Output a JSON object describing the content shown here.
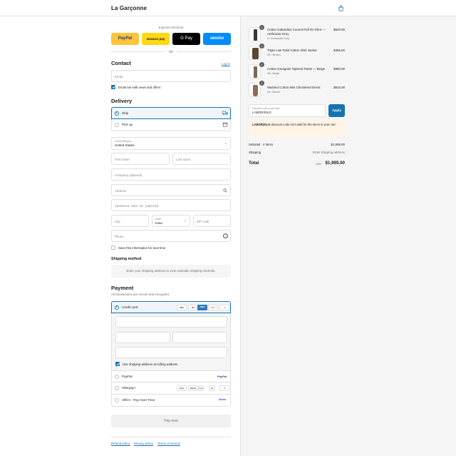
{
  "header": {
    "brand": "La Garçonne",
    "cart_icon": "shopping-bag-icon"
  },
  "express": {
    "label": "Express checkout",
    "or": "OR",
    "buttons": [
      {
        "label": "PayPal",
        "bg": "#ffc439",
        "color": "#253b80"
      },
      {
        "label": "amazon pay",
        "bg": "#ffd814",
        "color": "#0f1111"
      },
      {
        "label": "G Pay",
        "bg": "#000000",
        "color": "#ffffff"
      },
      {
        "label": "venmo",
        "bg": "#008cff",
        "color": "#ffffff"
      }
    ]
  },
  "contact": {
    "title": "Contact",
    "login": "Log in",
    "email_placeholder": "Email",
    "newsletter": "Email me with news and offers",
    "newsletter_checked": true
  },
  "delivery": {
    "title": "Delivery",
    "options": [
      {
        "label": "Ship",
        "selected": true,
        "icon": "truck-icon"
      },
      {
        "label": "Pick up",
        "selected": false,
        "icon": "store-icon"
      }
    ],
    "country_label": "Country/Region",
    "country_value": "United States",
    "first_name": "First name",
    "last_name": "Last name",
    "company": "Company (optional)",
    "address": "Address",
    "apartment": "Apartment, suite, etc. (optional)",
    "city": "City",
    "state_label": "State",
    "state_value": "Iowa",
    "zip": "ZIP code",
    "phone": "Phone",
    "save_info": "Save this information for next time"
  },
  "shipping_method": {
    "title": "Shipping method",
    "message": "Enter your shipping address to view available shipping methods."
  },
  "payment": {
    "title": "Payment",
    "subtitle": "All transactions are secure and encrypted.",
    "credit_card": "Credit card",
    "card_brands": [
      {
        "label": "VISA",
        "bg": "#ffffff",
        "color": "#1a1f71"
      },
      {
        "label": "MC",
        "bg": "#ffffff",
        "color": "#eb001b"
      },
      {
        "label": "AMEX",
        "bg": "#2e77bc",
        "color": "#ffffff"
      },
      {
        "label": "DISC",
        "bg": "#ffffff",
        "color": "#f48120"
      }
    ],
    "more_cards": "+4",
    "billing_same": "Use shipping address as billing address",
    "paypal": "PayPal",
    "paypal_logo": "PayPal",
    "afterpay": "Afterpay+",
    "afterpay_logos": [
      "Bank",
      "Klarna",
      "GPay",
      "AP"
    ],
    "afterpay_more": "+5",
    "affirm": "Affirm - Pay Over Time",
    "affirm_logo": "affirm",
    "pay_now": "Pay now"
  },
  "footer": {
    "links": [
      "Refund policy",
      "Privacy policy",
      "Terms of service"
    ]
  },
  "cart": {
    "items": [
      {
        "qty": "1",
        "name": "Cotton Gabardine Curved Pull On Pant — Anthracite Grey",
        "variant": "0 / Anthracite Grey",
        "price": "$520.00",
        "thumb_color": "#3a3a3a"
      },
      {
        "qty": "1",
        "name": "Triple Low Twist Cotton Shirt Jacket",
        "variant": "3S / Brown",
        "price": "$485.00",
        "thumb_color": "#5a4632"
      },
      {
        "qty": "1",
        "name": "Cotton Grosgrain Tapered Pants — Beige",
        "variant": "34 / Beige",
        "price": "$360.00",
        "thumb_color": "#7a6a55"
      },
      {
        "qty": "1",
        "name": "Washed Cotton Mini Checkered Dress",
        "variant": "34 / Brown",
        "price": "$615.00",
        "thumb_color": "#8a6e55"
      }
    ],
    "discount_label": "Discount code or gift card",
    "discount_value": "LABOR20LG",
    "apply": "Apply",
    "warning_code": "LABOR20LG",
    "warning_text": " discount code isn't valid for the items in your cart",
    "subtotal_label": "Subtotal · 4 items",
    "subtotal_value": "$1,995.00",
    "shipping_label": "Shipping",
    "shipping_value": "Enter shipping address",
    "total_label": "Total",
    "currency": "USD",
    "total_value": "$1,995.00"
  }
}
